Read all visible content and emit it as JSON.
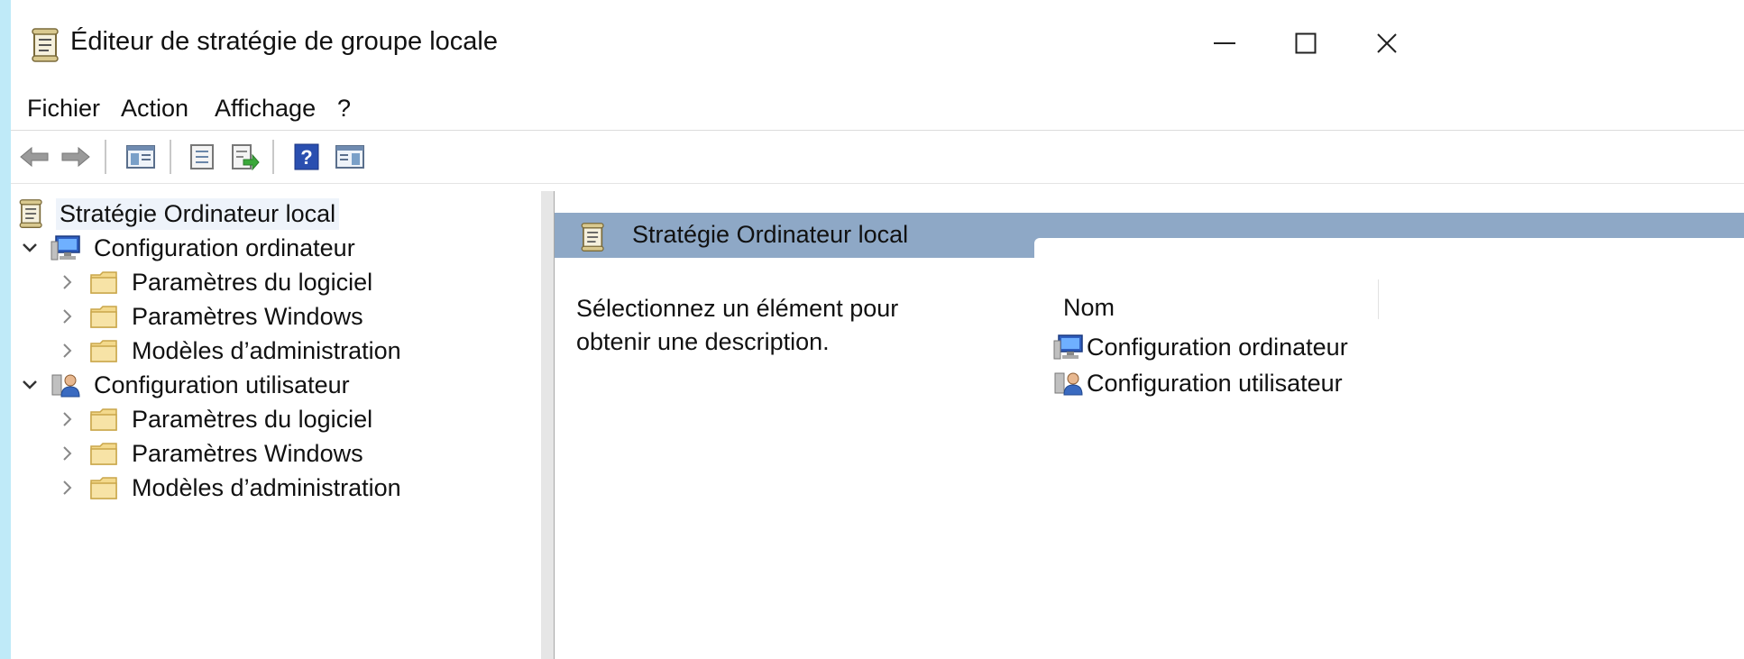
{
  "window": {
    "title": "Éditeur de stratégie de groupe locale",
    "icons": {
      "app": "policy-scroll-icon",
      "minimize": "minimize-icon",
      "maximize": "maximize-icon",
      "close": "close-icon"
    }
  },
  "menu": [
    {
      "label": "Fichier"
    },
    {
      "label": "Action"
    },
    {
      "label": "Affichage"
    },
    {
      "label": "?"
    }
  ],
  "toolbar": {
    "buttons": [
      {
        "icon": "back-arrow-icon"
      },
      {
        "icon": "forward-arrow-icon"
      },
      {
        "icon": "show-hide-console-tree-icon"
      },
      {
        "icon": "properties-icon"
      },
      {
        "icon": "export-list-icon"
      },
      {
        "icon": "help-icon"
      },
      {
        "icon": "show-hide-action-pane-icon"
      }
    ]
  },
  "tree": {
    "root": {
      "label": "Stratégie Ordinateur local",
      "icon": "policy-scroll-icon",
      "selected": true
    },
    "nodes": [
      {
        "label": "Configuration ordinateur",
        "icon": "computer-config-icon",
        "expanded": true,
        "children": [
          {
            "label": "Paramètres du logiciel",
            "icon": "folder-icon"
          },
          {
            "label": "Paramètres Windows",
            "icon": "folder-icon"
          },
          {
            "label": "Modèles d’administration",
            "icon": "folder-icon"
          }
        ]
      },
      {
        "label": "Configuration utilisateur",
        "icon": "user-config-icon",
        "expanded": true,
        "children": [
          {
            "label": "Paramètres du logiciel",
            "icon": "folder-icon"
          },
          {
            "label": "Paramètres Windows",
            "icon": "folder-icon"
          },
          {
            "label": "Modèles d’administration",
            "icon": "folder-icon"
          }
        ]
      }
    ]
  },
  "details": {
    "header_title": "Stratégie Ordinateur local",
    "description": "Sélectionnez un élément pour obtenir une description.",
    "column_name": "Nom",
    "items": [
      {
        "label": "Configuration ordinateur",
        "icon": "computer-config-icon"
      },
      {
        "label": "Configuration utilisateur",
        "icon": "user-config-icon"
      }
    ]
  },
  "colors": {
    "desktop_background": "#bfeaf8",
    "header_band": "#8ea8c6",
    "folder": "#f3d98c",
    "window_background": "#ffffff"
  }
}
